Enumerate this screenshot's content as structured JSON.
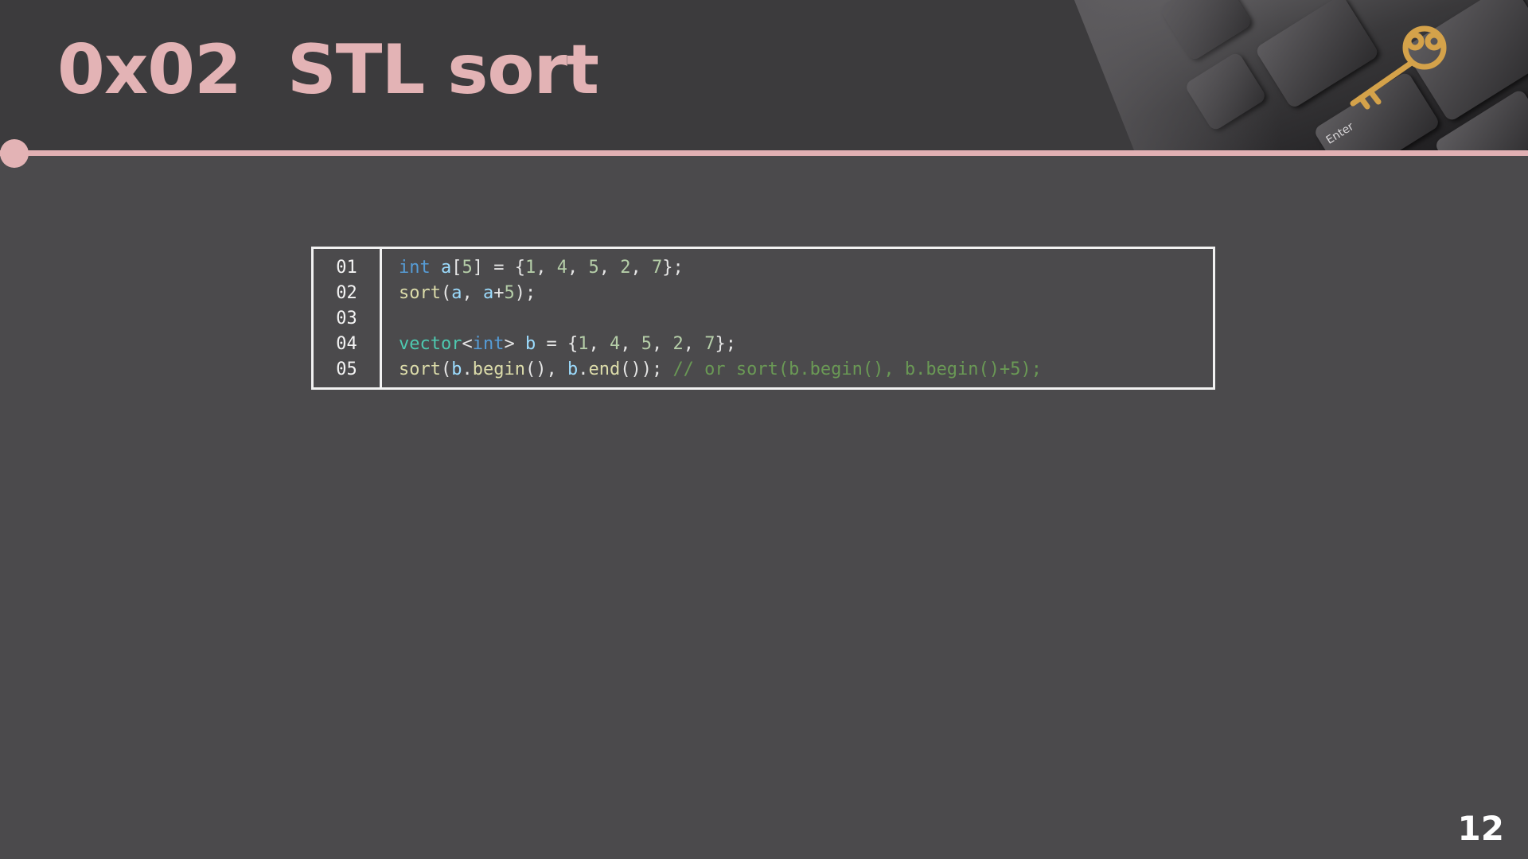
{
  "slide": {
    "title": "0x02  STL sort",
    "page_number": "12",
    "photo_caption": "Enter",
    "colors": {
      "accent": "#e3b3b5",
      "background": "#4b4a4c",
      "header": "#3c3b3d"
    }
  },
  "code": {
    "line_numbers": [
      "01",
      "02",
      "03",
      "04",
      "05"
    ],
    "lines": [
      [
        {
          "t": "int",
          "c": "kw"
        },
        {
          "t": " ",
          "c": "pn"
        },
        {
          "t": "a",
          "c": "var"
        },
        {
          "t": "[",
          "c": "pn"
        },
        {
          "t": "5",
          "c": "num"
        },
        {
          "t": "] = {",
          "c": "pn"
        },
        {
          "t": "1",
          "c": "num"
        },
        {
          "t": ", ",
          "c": "pn"
        },
        {
          "t": "4",
          "c": "num"
        },
        {
          "t": ", ",
          "c": "pn"
        },
        {
          "t": "5",
          "c": "num"
        },
        {
          "t": ", ",
          "c": "pn"
        },
        {
          "t": "2",
          "c": "num"
        },
        {
          "t": ", ",
          "c": "pn"
        },
        {
          "t": "7",
          "c": "num"
        },
        {
          "t": "};",
          "c": "pn"
        }
      ],
      [
        {
          "t": "sort",
          "c": "fn"
        },
        {
          "t": "(",
          "c": "pn"
        },
        {
          "t": "a",
          "c": "var"
        },
        {
          "t": ", ",
          "c": "pn"
        },
        {
          "t": "a",
          "c": "var"
        },
        {
          "t": "+",
          "c": "pn"
        },
        {
          "t": "5",
          "c": "num"
        },
        {
          "t": ");",
          "c": "pn"
        }
      ],
      [],
      [
        {
          "t": "vector",
          "c": "ty"
        },
        {
          "t": "<",
          "c": "pn"
        },
        {
          "t": "int",
          "c": "kw"
        },
        {
          "t": "> ",
          "c": "pn"
        },
        {
          "t": "b",
          "c": "var"
        },
        {
          "t": " = {",
          "c": "pn"
        },
        {
          "t": "1",
          "c": "num"
        },
        {
          "t": ", ",
          "c": "pn"
        },
        {
          "t": "4",
          "c": "num"
        },
        {
          "t": ", ",
          "c": "pn"
        },
        {
          "t": "5",
          "c": "num"
        },
        {
          "t": ", ",
          "c": "pn"
        },
        {
          "t": "2",
          "c": "num"
        },
        {
          "t": ", ",
          "c": "pn"
        },
        {
          "t": "7",
          "c": "num"
        },
        {
          "t": "};",
          "c": "pn"
        }
      ],
      [
        {
          "t": "sort",
          "c": "fn"
        },
        {
          "t": "(",
          "c": "pn"
        },
        {
          "t": "b",
          "c": "var"
        },
        {
          "t": ".",
          "c": "pn"
        },
        {
          "t": "begin",
          "c": "fn"
        },
        {
          "t": "(), ",
          "c": "pn"
        },
        {
          "t": "b",
          "c": "var"
        },
        {
          "t": ".",
          "c": "pn"
        },
        {
          "t": "end",
          "c": "fn"
        },
        {
          "t": "()); ",
          "c": "pn"
        },
        {
          "t": "// or sort(b.begin(), b.begin()+5);",
          "c": "cm"
        }
      ]
    ]
  }
}
